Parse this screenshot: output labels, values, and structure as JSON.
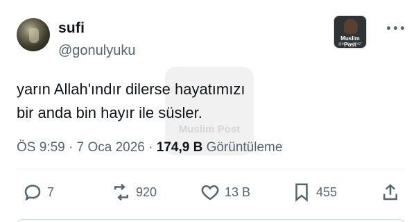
{
  "author": {
    "display_name": "sufi",
    "handle": "@gonulyuku"
  },
  "badge": {
    "title": "Muslim Post",
    "subtitle": "@MuslimPOST"
  },
  "tweet": {
    "text": "yarın Allah'ındır dilerse hayatımızı\nbir anda bin hayır ile süsler."
  },
  "watermark": {
    "text": "Muslim Post"
  },
  "meta": {
    "time": "ÖS 9:59",
    "separator": "·",
    "date": "7 Oca 2026",
    "views_count": "174,9 B",
    "views_label": "Görüntüleme"
  },
  "actions": {
    "replies": "7",
    "reposts": "920",
    "likes": "13 B",
    "bookmarks": "455"
  }
}
